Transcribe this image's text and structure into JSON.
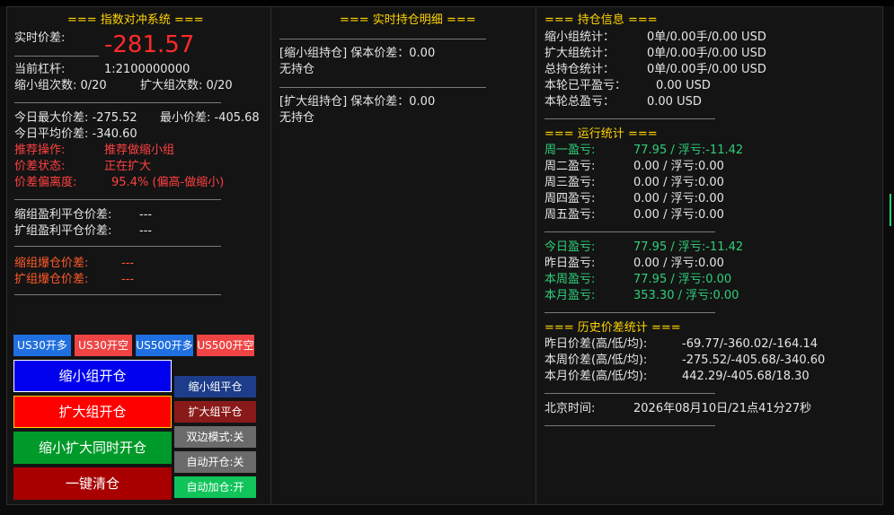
{
  "left": {
    "title": "=== 指数对冲系统 ===",
    "spread_label": "实时价差:",
    "spread_value": "-281.57",
    "leverage_label": "当前杠杆:",
    "leverage_value": "1:2100000000",
    "shrink_count_label": "缩小组次数: 0/20",
    "expand_count_label": "扩大组次数: 0/20",
    "today_max": "今日最大价差: -275.52",
    "today_min": "最小价差: -405.68",
    "today_avg": "今日平均价差: -340.60",
    "recommend_label": "推荐操作:",
    "recommend_value": "推荐做缩小组",
    "spread_state_label": "价差状态:",
    "spread_state_value": "正在扩大",
    "deviation_label": "价差偏离度:",
    "deviation_value": "95.4% (偏高-做缩小)",
    "shrink_tp_label": "缩组盈利平仓价差:",
    "shrink_tp_value": "---",
    "expand_tp_label": "扩组盈利平仓价差:",
    "expand_tp_value": "---",
    "shrink_liq_label": "缩组爆仓价差:",
    "shrink_liq_value": "---",
    "expand_liq_label": "扩组爆仓价差:",
    "expand_liq_value": "---"
  },
  "buttons": {
    "us30_long": "US30开多",
    "us30_short": "US30开空",
    "us500_long": "US500开多",
    "us500_short": "US500开空",
    "open_shrink": "缩小组开仓",
    "open_expand": "扩大组开仓",
    "open_both": "缩小扩大同时开仓",
    "close_all": "一键清仓",
    "close_shrink": "缩小组平仓",
    "close_expand": "扩大组平仓",
    "bidir_mode": "双边模式:关",
    "auto_open": "自动开仓:关",
    "auto_add": "自动加仓:开"
  },
  "middle": {
    "title": "=== 实时持仓明细 ===",
    "shrink_pos_label": "[缩小组持仓] 保本价差：0.00",
    "shrink_pos_status": "无持仓",
    "expand_pos_label": "[扩大组持仓] 保本价差：0.00",
    "expand_pos_status": "无持仓"
  },
  "right": {
    "pos_title": "=== 持仓信息 ===",
    "shrink_stat_label": "缩小组统计：",
    "shrink_stat_value": "0单/0.00手/0.00 USD",
    "expand_stat_label": "扩大组统计：",
    "expand_stat_value": "0单/0.00手/0.00 USD",
    "total_stat_label": "总持仓统计：",
    "total_stat_value": "0单/0.00手/0.00 USD",
    "round_closed_label": "本轮已平盈亏：",
    "round_closed_value": "0.00 USD",
    "round_total_label": "本轮总盈亏：",
    "round_total_value": "0.00 USD",
    "run_title": "=== 运行统计 ===",
    "mon_label": "周一盈亏:",
    "mon_value": "77.95 / 浮亏:-11.42",
    "tue_label": "周二盈亏:",
    "tue_value": "0.00 / 浮亏:0.00",
    "wed_label": "周三盈亏:",
    "wed_value": "0.00 / 浮亏:0.00",
    "thu_label": "周四盈亏:",
    "thu_value": "0.00 / 浮亏:0.00",
    "fri_label": "周五盈亏:",
    "fri_value": "0.00 / 浮亏:0.00",
    "today_label": "今日盈亏:",
    "today_value": "77.95 / 浮亏:-11.42",
    "yest_label": "昨日盈亏:",
    "yest_value": "0.00 / 浮亏:0.00",
    "week_label": "本周盈亏:",
    "week_value": "77.95 / 浮亏:0.00",
    "month_label": "本月盈亏:",
    "month_value": "353.30 / 浮亏:0.00",
    "hist_title": "=== 历史价差统计 ===",
    "yest_spread_label": "昨日价差(高/低/均):",
    "yest_spread_value": "-69.77/-360.02/-164.14",
    "week_spread_label": "本周价差(高/低/均):",
    "week_spread_value": "-275.52/-405.68/-340.60",
    "month_spread_label": "本月价差(高/低/均):",
    "month_spread_value": "442.29/-405.68/18.30",
    "bj_time_label": "北京时间:",
    "bj_time_value": "2026年08月10日/21点41分27秒"
  },
  "colors": {
    "title": "#ffd400",
    "alert": "#ff4040",
    "liq": "#ff5a2a",
    "profit": "#2ed07a",
    "btn_blue": "#1f6fe0",
    "btn_red": "#ef4444",
    "btn_dark_blue": "#1d3d8a",
    "btn_dark_red": "#8a1a1a",
    "btn_gray": "#6b6b6b",
    "btn_green": "#10c45a"
  }
}
